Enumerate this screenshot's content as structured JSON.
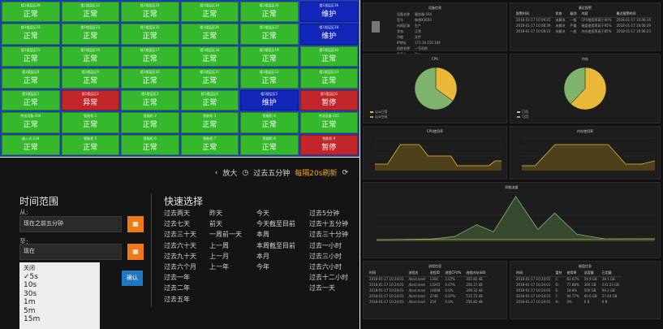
{
  "grid": {
    "tiles": [
      {
        "title": "楼1楼层区29",
        "status": "正常",
        "state": "ok"
      },
      {
        "title": "楼1楼层区32",
        "status": "正常",
        "state": "ok"
      },
      {
        "title": "楼1楼层区33",
        "status": "正常",
        "state": "ok"
      },
      {
        "title": "楼1楼层区34",
        "status": "正常",
        "state": "ok"
      },
      {
        "title": "楼1楼层区35",
        "status": "正常",
        "state": "ok"
      },
      {
        "title": "楼1楼层区36",
        "status": "维护",
        "state": "maint"
      },
      {
        "title": "楼1楼层区22",
        "status": "正常",
        "state": "ok"
      },
      {
        "title": "楼1楼层区23",
        "status": "正常",
        "state": "ok"
      },
      {
        "title": "楼1楼层区25",
        "status": "正常",
        "state": "ok"
      },
      {
        "title": "楼1楼层区26",
        "status": "正常",
        "state": "ok"
      },
      {
        "title": "楼1楼层区27",
        "status": "正常",
        "state": "ok"
      },
      {
        "title": "楼1楼层区28",
        "status": "维护",
        "state": "maint"
      },
      {
        "title": "楼1楼层区15",
        "status": "正常",
        "state": "ok"
      },
      {
        "title": "楼1楼层区16",
        "status": "正常",
        "state": "ok"
      },
      {
        "title": "楼1楼层区17",
        "status": "正常",
        "state": "ok"
      },
      {
        "title": "楼1楼层区18",
        "status": "正常",
        "state": "ok"
      },
      {
        "title": "楼1楼层区19",
        "status": "正常",
        "state": "ok"
      },
      {
        "title": "楼1楼层区20",
        "status": "正常",
        "state": "ok"
      },
      {
        "title": "楼1楼层区8",
        "status": "正常",
        "state": "ok"
      },
      {
        "title": "楼1楼层区9",
        "status": "正常",
        "state": "ok"
      },
      {
        "title": "楼1楼层区10",
        "status": "正常",
        "state": "ok"
      },
      {
        "title": "楼1楼层区11",
        "status": "正常",
        "state": "ok"
      },
      {
        "title": "楼1楼层区12",
        "status": "正常",
        "state": "ok"
      },
      {
        "title": "楼1楼层区13",
        "status": "正常",
        "state": "ok"
      },
      {
        "title": "楼1楼层区1",
        "status": "正常",
        "state": "ok"
      },
      {
        "title": "楼1楼层区2",
        "status": "异常",
        "state": "err"
      },
      {
        "title": "楼1楼层区3",
        "status": "正常",
        "state": "ok"
      },
      {
        "title": "楼1楼层区4",
        "status": "正常",
        "state": "ok"
      },
      {
        "title": "楼1楼层区5",
        "status": "维护",
        "state": "maint"
      },
      {
        "title": "楼1楼层区6",
        "status": "暂停",
        "state": "err"
      },
      {
        "title": "传送设备-204",
        "status": "正常",
        "state": "ok"
      },
      {
        "title": "智能柜-1",
        "status": "正常",
        "state": "ok"
      },
      {
        "title": "智能柜-2",
        "status": "正常",
        "state": "ok"
      },
      {
        "title": "智能柜-3",
        "status": "正常",
        "state": "ok"
      },
      {
        "title": "智能柜-4",
        "status": "正常",
        "state": "ok"
      },
      {
        "title": "传送设备-205",
        "status": "正常",
        "state": "ok"
      },
      {
        "title": "嵌入式-239",
        "status": "正常",
        "state": "ok"
      },
      {
        "title": "智能柜-5",
        "status": "正常",
        "state": "ok"
      },
      {
        "title": "智能柜-6",
        "status": "正常",
        "state": "ok"
      },
      {
        "title": "智能柜-7",
        "status": "正常",
        "state": "ok"
      },
      {
        "title": "智能柜-8",
        "status": "正常",
        "state": "ok"
      },
      {
        "title": "智能柜-9",
        "status": "暂停",
        "state": "err"
      }
    ]
  },
  "colors": {
    "ok": "#35b82b",
    "maint": "#1226b8",
    "err": "#c0262a",
    "accent": "#eb7b18",
    "dashGreen": "#7eb26d",
    "dashYellow": "#eab839"
  },
  "timepicker": {
    "zoom_label": "放大",
    "range_label": "过去五分钟",
    "refresh_label": "每隔20s刷新",
    "title": "时间范围",
    "from_label": "从:",
    "from_value": "现在之前五分钟",
    "to_label": "至:",
    "to_value": "现在",
    "quick_title": "快速选择",
    "apply_label": "确认",
    "quick_cols": [
      [
        "过去两天",
        "过去七天",
        "过去三十天",
        "过去六十天",
        "过去九十天",
        "过去六个月",
        "过去一年",
        "过去二年",
        "过去五年"
      ],
      [
        "昨天",
        "前天",
        "一周前一天",
        "上一周",
        "上一月",
        "上一年"
      ],
      [
        "今天",
        "今天截至目前",
        "本周",
        "本周截至目前",
        "本月",
        "今年"
      ],
      [
        "过去5分钟",
        "过去十五分钟",
        "过去三十分钟",
        "过去一小时",
        "过去三小时",
        "过去六小时",
        "过去十二小时",
        "过去一天"
      ]
    ],
    "refresh_options": [
      "关闭",
      "5s",
      "10s",
      "30s",
      "1m",
      "5m",
      "15m"
    ],
    "refresh_selected": "5s"
  },
  "dashboard": {
    "info_title": "设备信息",
    "info_rows": [
      [
        "设备名称",
        "服务器-164"
      ],
      [
        "型号",
        "联想X3650"
      ],
      [
        "内网区域",
        "生产"
      ],
      [
        "状态",
        "正常"
      ],
      [
        "功能",
        "文件"
      ],
      [
        "IP地址",
        "172.16.150.164"
      ],
      [
        "机房名称",
        "一号机房"
      ],
      [
        "负责人",
        "张三"
      ]
    ],
    "alerts_title": "最近报警",
    "alerts_head": [
      "报警时间",
      "状态",
      "级别",
      "内容",
      "最近报警时间"
    ],
    "alerts_rows": [
      [
        "2018-01-17 10:09:25",
        "未解决",
        "一般",
        "CPU使用率高于90%",
        "2018-01-17 10:06:16"
      ],
      [
        "2018-01-17 10:08:39",
        "未解决",
        "严重",
        "磁盘使用率高于95%",
        "2018-01-17 10:06:39"
      ],
      [
        "2018-01-17 10:08:23",
        "未解决",
        "一般",
        "内存使用率高于85%",
        "2018-01-17 10:06:23"
      ]
    ],
    "cpu_title": "CPU",
    "mem_title": "内存",
    "cpu_pie": [
      {
        "name": "cpu已用",
        "value": 35
      },
      {
        "name": "cpu空闲",
        "value": 65
      }
    ],
    "mem_pie": [
      {
        "name": "已用",
        "value": 62
      },
      {
        "name": "可用",
        "value": 38
      }
    ],
    "cpu_trend_title": "CPU使用率",
    "mem_trend_title": "内存使用率",
    "net_title": "网络流量",
    "disk_title": "磁盘信息",
    "proc_title": "进程信息",
    "proc_head": [
      "时间",
      "进程名",
      "进程ID",
      "进程CPU%",
      "进程内存(kB)"
    ],
    "proc_rows": [
      [
        "2018-01-17 10:24:01",
        "/bin/crond",
        "1304",
        "2.07%",
        "355.82 kB"
      ],
      [
        "2018-01-17 10:24:01",
        "/bin/crond",
        "13245",
        "0.07%",
        "256.37 kB"
      ],
      [
        "2018-01-17 10:24:01",
        "/bin/crond",
        "14098",
        "0.0%",
        "309.32 kB"
      ],
      [
        "2018-01-17 10:24:01",
        "/bin/crond",
        "2746",
        "0.07%",
        "512.73 kB"
      ],
      [
        "2018-01-17 10:24:01",
        "/bin/crond",
        "354",
        "0.0%",
        "256.82 kB"
      ]
    ],
    "disk_head": [
      "时间",
      "盘符",
      "使用率",
      "总容量",
      "已用量"
    ],
    "disk_rows": [
      [
        "2018-01-17 10:24:01",
        "C:",
        "63.67%",
        "59.9 GB",
        "38.1 GB"
      ],
      [
        "2018-01-17 10:24:01",
        "D:",
        "77.88%",
        "300 GB",
        "231.23 GB"
      ],
      [
        "2018-01-17 10:24:01",
        "E:",
        "18.8%",
        "500 GB",
        "94.3 GB"
      ],
      [
        "2018-01-17 10:24:01",
        "F:",
        "94.77%",
        "60.6 GB",
        "57.44 GB"
      ],
      [
        "2018-01-17 10:24:01",
        "H:",
        "0%",
        "0 B",
        "0 B"
      ]
    ]
  }
}
